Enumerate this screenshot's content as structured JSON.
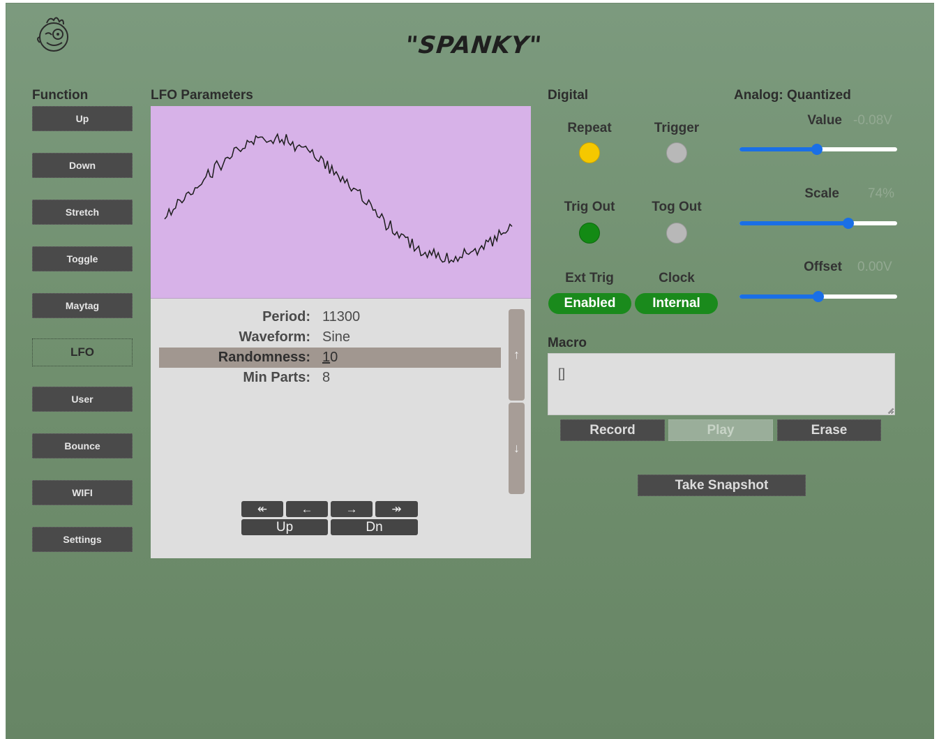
{
  "header": {
    "title": "\"SPANKY\"",
    "logo_icon": "cartoon-face-icon"
  },
  "function": {
    "title": "Function",
    "items": [
      {
        "label": "Up",
        "active": false
      },
      {
        "label": "Down",
        "active": false
      },
      {
        "label": "Stretch",
        "active": false
      },
      {
        "label": "Toggle",
        "active": false
      },
      {
        "label": "Maytag",
        "active": false
      },
      {
        "label": "LFO",
        "active": true
      },
      {
        "label": "User",
        "active": false
      },
      {
        "label": "Bounce",
        "active": false
      },
      {
        "label": "WIFI",
        "active": false
      },
      {
        "label": "Settings",
        "active": false
      }
    ]
  },
  "lfo": {
    "title": "LFO Parameters",
    "params": [
      {
        "label": "Period:",
        "value": "11300",
        "selected": false
      },
      {
        "label": "Waveform:",
        "value": "Sine",
        "selected": false
      },
      {
        "label": "Randomness:",
        "value": "10",
        "selected": true
      },
      {
        "label": "Min Parts:",
        "value": "8",
        "selected": false
      }
    ],
    "scroll": {
      "up": "↑",
      "down": "↓"
    },
    "nav": {
      "first": "↞",
      "prev": "←",
      "next": "→",
      "last": "↠",
      "up": "Up",
      "dn": "Dn"
    }
  },
  "digital": {
    "title": "Digital",
    "repeat": {
      "label": "Repeat",
      "color": "#f5c800"
    },
    "trigger": {
      "label": "Trigger",
      "color": "#b8b8b8"
    },
    "trig_out": {
      "label": "Trig Out",
      "color": "#138a14"
    },
    "tog_out": {
      "label": "Tog Out",
      "color": "#b8b8b8"
    },
    "ext_trig": {
      "label": "Ext Trig",
      "state": "Enabled"
    },
    "clock": {
      "label": "Clock",
      "state": "Internal"
    }
  },
  "analog": {
    "title": "Analog: Quantized",
    "value": {
      "label": "Value",
      "display": "-0.08V",
      "fraction": 0.49
    },
    "scale": {
      "label": "Scale",
      "display": "74%",
      "fraction": 0.69
    },
    "offset": {
      "label": "Offset",
      "display": "0.00V",
      "fraction": 0.5
    }
  },
  "macro": {
    "title": "Macro",
    "content": "[]",
    "record": "Record",
    "play": "Play",
    "erase": "Erase",
    "snapshot": "Take Snapshot"
  }
}
